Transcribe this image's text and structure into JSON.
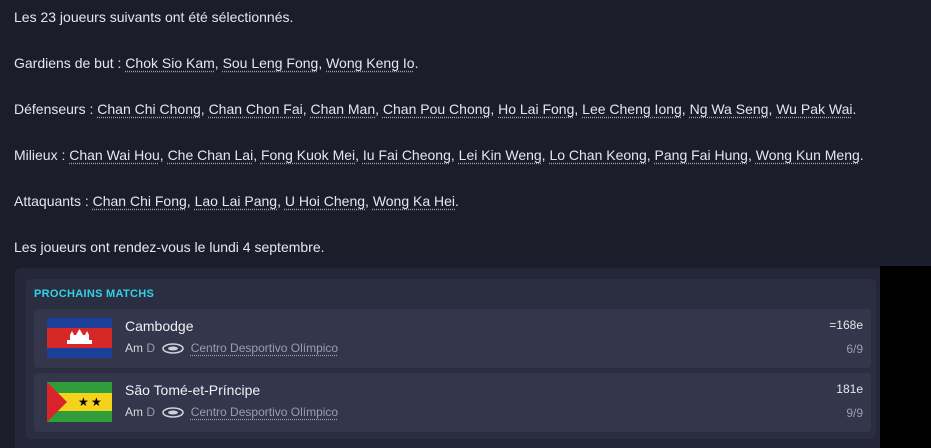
{
  "intro": "Les 23 joueurs suivants ont été sélectionnés.",
  "groups": [
    {
      "label": "Gardiens de but :",
      "players": [
        "Chok Sio Kam",
        "Sou Leng Fong",
        "Wong Keng Io"
      ]
    },
    {
      "label": "Défenseurs :",
      "players": [
        "Chan Chi Chong",
        "Chan Chon Fai",
        "Chan Man",
        "Chan Pou Chong",
        "Ho Lai Fong",
        "Lee Cheng Iong",
        "Ng Wa Seng",
        "Wu Pak Wai"
      ]
    },
    {
      "label": "Milieux :",
      "players": [
        "Chan Wai Hou",
        "Che Chan Lai",
        "Fong Kuok Mei",
        "Iu Fai Cheong",
        "Lei Kin Weng",
        "Lo Chan Keong",
        "Pang Fai Hung",
        "Wong Kun Meng"
      ]
    },
    {
      "label": "Attaquants :",
      "players": [
        "Chan Chi Fong",
        "Lao Lai Pang",
        "U Hoi Cheng",
        "Wong Ka Hei"
      ]
    }
  ],
  "rendezvous": "Les joueurs ont rendez-vous le lundi 4 septembre.",
  "upcoming": {
    "title": "PROCHAINS MATCHS",
    "matches": [
      {
        "team": "Cambodge",
        "competition": "Am",
        "venue_type": "D",
        "stadium": "Centro Desportivo Olímpico",
        "rank": "=168e",
        "date": "6/9",
        "flag_icon": "cambodia-flag-icon"
      },
      {
        "team": "São Tomé-et-Príncipe",
        "competition": "Am",
        "venue_type": "D",
        "stadium": "Centro Desportivo Olímpico",
        "rank": "181e",
        "date": "9/9",
        "flag_icon": "sao-tome-flag-icon"
      }
    ]
  },
  "colors": {
    "background": "#1c1d2a",
    "accent": "#2fd4e6",
    "card": "#34374c"
  }
}
